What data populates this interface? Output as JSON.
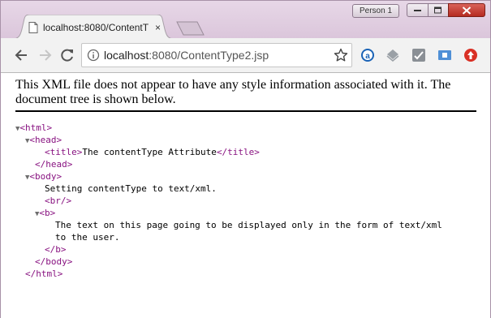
{
  "window": {
    "profile_label": "Person 1"
  },
  "tab": {
    "title": "localhost:8080/ContentT",
    "close_glyph": "×"
  },
  "toolbar": {
    "url_host": "localhost",
    "url_path": ":8080/ContentType2.jsp",
    "icons": [
      "back-icon",
      "forward-icon",
      "reload-icon",
      "info-icon",
      "star-icon",
      "amazon-extension-icon",
      "layers-extension-icon",
      "checklist-extension-icon",
      "screen-extension-icon",
      "alert-extension-icon"
    ]
  },
  "content": {
    "notice": "This XML file does not appear to have any style information associated with it. The document tree is shown below.",
    "tree": {
      "html_open": "<html>",
      "head_open": "<head>",
      "title_open": "<title>",
      "title_text": "The contentType Attribute",
      "title_close": "</title>",
      "head_close": "</head>",
      "body_open": "<body>",
      "body_text": "Setting contentType to text/xml.",
      "br": "<br/>",
      "b_open": "<b>",
      "b_text_1": "The text on this page going to be displayed only in the form of text/xml",
      "b_text_2": "to the user.",
      "b_close": "</b>",
      "body_close": "</body>",
      "html_close": "</html>",
      "triangle": "▼"
    }
  },
  "colors": {
    "tag": "#881280",
    "frame": "#dcc9dc",
    "close_button": "#c7392f"
  }
}
